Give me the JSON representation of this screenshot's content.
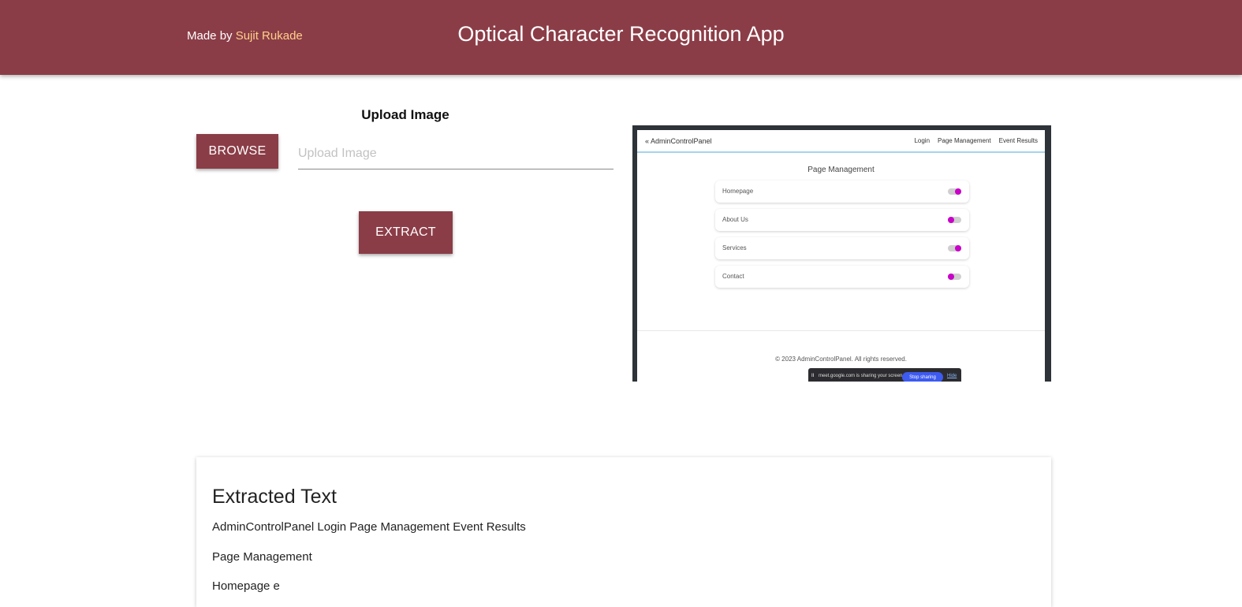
{
  "header": {
    "credit_prefix": "Made by ",
    "credit_author": "Sujit Rukade",
    "app_title": "Optical Character Recognition App"
  },
  "upload": {
    "heading": "Upload Image",
    "browse_label": "BROWSE",
    "input_placeholder": "Upload Image",
    "extract_label": "EXTRACT"
  },
  "preview": {
    "brand": "AdminControlPanel",
    "nav_links": [
      "Login",
      "Page Management",
      "Event Results"
    ],
    "heading": "Page Management",
    "cards": [
      {
        "label": "Homepage",
        "on": true
      },
      {
        "label": "About Us",
        "on": false
      },
      {
        "label": "Services",
        "on": true
      },
      {
        "label": "Contact",
        "on": false
      }
    ],
    "footer": "© 2023 AdminControlPanel. All rights reserved.",
    "share_pause": "II",
    "share_message": "meet.google.com is sharing your screen.",
    "share_stop": "Stop sharing",
    "share_hide": "Hide"
  },
  "result": {
    "title": "Extracted Text",
    "lines": [
      "AdminControlPanel Login Page Management Event Results",
      "Page Management",
      "Homepage e"
    ]
  },
  "colors": {
    "brand": "#8b3d47",
    "author_link": "#ffd08a",
    "toggle_knob": "#c800c8",
    "stop_button": "#3d5af1"
  }
}
